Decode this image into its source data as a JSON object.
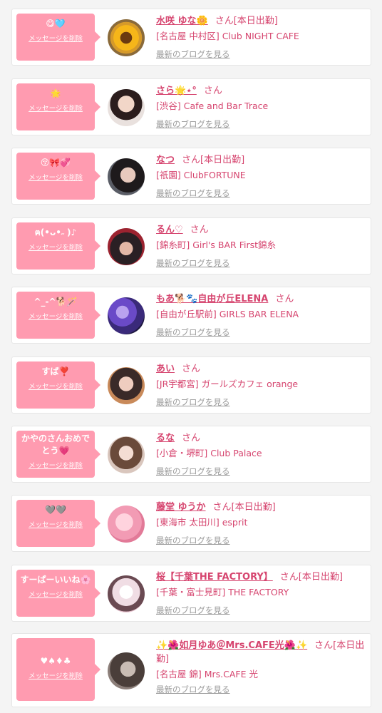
{
  "delete_label": "メッセージを削除",
  "blog_label": "最新のブログを見る",
  "colors": {
    "bubble": "#ff9bb0",
    "accent": "#d6456f",
    "muted": "#9a9a9a"
  },
  "items": [
    {
      "message": "😋🩵",
      "name": "水咲 ゆな🌼",
      "suffix": "さん[本日出勤]",
      "shop": "[名古屋 中村区] Club NIGHT CAFE",
      "avatar_icon": "sunflower-avatar"
    },
    {
      "message": "🌟",
      "name": "さら🌟⋆°",
      "suffix": "さん",
      "shop": "[渋谷] Cafe and Bar Trace",
      "avatar_icon": "girl-photo-avatar"
    },
    {
      "message": "😚🎀💞",
      "name": "なつ",
      "suffix": "さん[本日出勤]",
      "shop": "[祇園] ClubFORTUNE",
      "avatar_icon": "girl-photo-avatar"
    },
    {
      "message": "ฅ(•ᴗ•˶ )♪",
      "name": "るん♡",
      "suffix": "さん",
      "shop": "[錦糸町] Girl's BAR First錦糸",
      "avatar_icon": "girl-photo-avatar"
    },
    {
      "message": "^_-^🐕🪄",
      "name": "もあ🐕🐾自由が丘ELENA",
      "suffix": "さん",
      "shop": "[自由が丘駅前] GIRLS BAR ELENA",
      "avatar_icon": "balloon-photo-avatar"
    },
    {
      "message": "すば❣️",
      "name": "あい",
      "suffix": "さん",
      "shop": "[JR宇都宮] ガールズカフェ orange",
      "avatar_icon": "girl-photo-avatar"
    },
    {
      "message": "かやのさんおめでとう💗",
      "name": "るな",
      "suffix": "さん",
      "shop": "[小倉・堺町] Club Palace",
      "avatar_icon": "girl-photo-avatar"
    },
    {
      "message": "🩶🩶",
      "name": "藤堂 ゆうか",
      "suffix": "さん[本日出勤]",
      "shop": "[東海市 太田川] esprit",
      "avatar_icon": "pink-photo-avatar"
    },
    {
      "message": "すーぱーいいね🌸",
      "name": "桜【千葉THE FACTORY】",
      "suffix": "さん[本日出勤]",
      "shop": "[千葉・富士見町] THE FACTORY",
      "avatar_icon": "girl-photo-avatar"
    },
    {
      "message": "♥♠♦♣",
      "name": "✨🌺如月ゆあ＠Mrs.CAFE光🌺✨",
      "suffix": "さん[本日出勤]",
      "shop": "[名古屋 錦] Mrs.CAFE 光",
      "avatar_icon": "girl-photo-avatar"
    }
  ]
}
